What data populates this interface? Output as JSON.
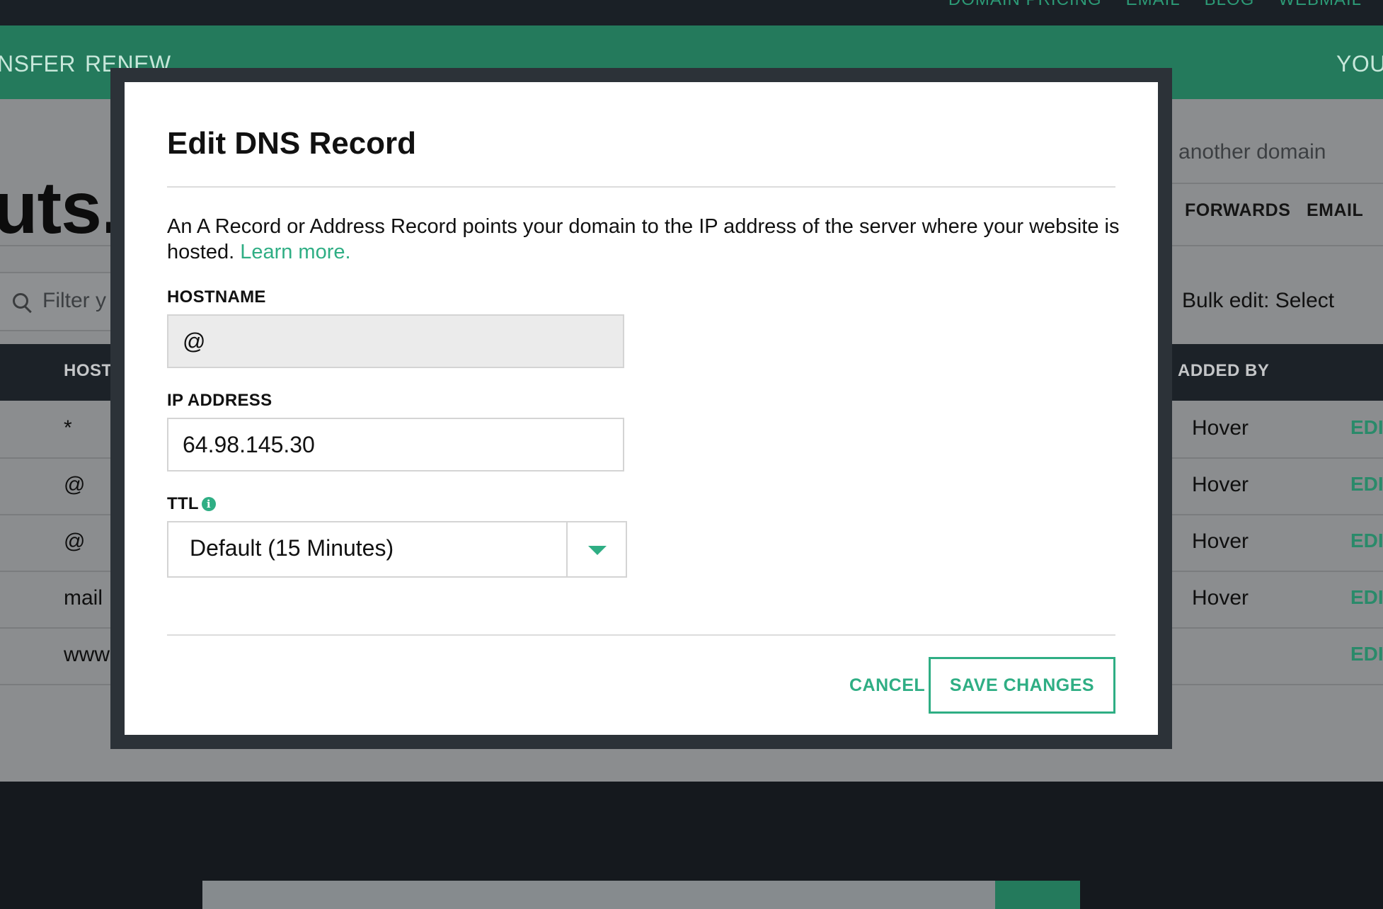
{
  "top_links": [
    "DOMAIN PRICING",
    "EMAIL",
    "BLOG",
    "WEBMAIL"
  ],
  "nav": {
    "left_items": [
      "NSFER",
      "RENEW"
    ],
    "right_item": "YOU"
  },
  "page": {
    "domain_fragment": "uts.c",
    "search_other_placeholder": "o another domain",
    "tabs": [
      "FORWARDS",
      "EMAIL"
    ],
    "filter_placeholder": "Filter y",
    "bulk_edit": "Bulk edit: Select",
    "table": {
      "headers": {
        "host": "HOST",
        "added_by": "ADDED BY"
      },
      "rows": [
        {
          "host": "*",
          "added_by": "Hover",
          "action": "EDIT"
        },
        {
          "host": "@",
          "added_by": "Hover",
          "action": "EDIT"
        },
        {
          "host": "@",
          "added_by": "Hover",
          "action": "EDIT"
        },
        {
          "host": "mail",
          "added_by": "Hover",
          "action": "EDIT"
        },
        {
          "host": "www",
          "added_by": "",
          "action": "EDIT"
        }
      ]
    }
  },
  "modal": {
    "title": "Edit DNS Record",
    "description": "An A Record or Address Record points your domain to the IP address of the server where your website is hosted.",
    "learn_more": "Learn more.",
    "hostname": {
      "label": "HOSTNAME",
      "value": "@"
    },
    "ip_address": {
      "label": "IP ADDRESS",
      "value": "64.98.145.30"
    },
    "ttl": {
      "label": "TTL",
      "info_icon": "i",
      "value": "Default (15 Minutes)"
    },
    "cancel_label": "CANCEL",
    "save_label": "SAVE CHANGES"
  },
  "colors": {
    "accent": "#2fae84",
    "nav_green": "#247a5c",
    "overlay": "#8b8d8f",
    "dark": "#15191e"
  }
}
